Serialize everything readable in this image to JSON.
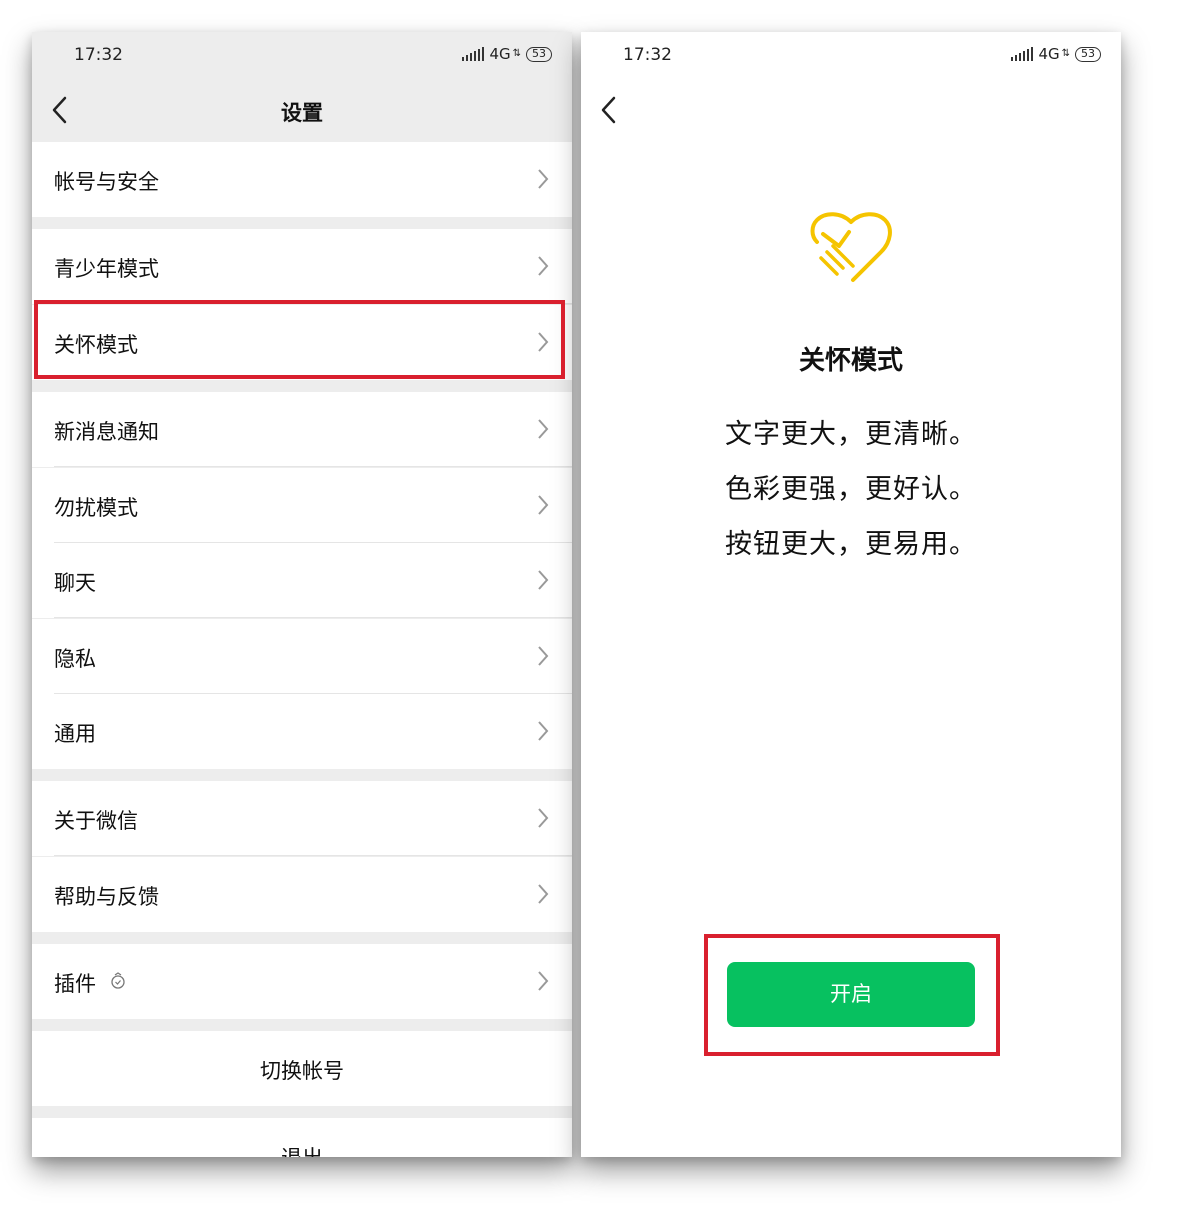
{
  "left_screen": {
    "status": {
      "time": "17:32",
      "network": "4G",
      "battery": "53"
    },
    "nav": {
      "title": "设置"
    },
    "items": [
      {
        "label": "帐号与安全"
      },
      {
        "label": "青少年模式"
      },
      {
        "label": "关怀模式"
      },
      {
        "label": "新消息通知"
      },
      {
        "label": "勿扰模式"
      },
      {
        "label": "聊天"
      },
      {
        "label": "隐私"
      },
      {
        "label": "通用"
      },
      {
        "label": "关于微信"
      },
      {
        "label": "帮助与反馈"
      },
      {
        "label": "插件"
      }
    ],
    "switch_account": "切换帐号",
    "logout": "退出"
  },
  "right_screen": {
    "status": {
      "time": "17:32",
      "network": "4G",
      "battery": "53"
    },
    "title": "关怀模式",
    "lines": [
      "文字更大，更清晰。",
      "色彩更强，更好认。",
      "按钮更大，更易用。"
    ],
    "button_label": "开启"
  },
  "colors": {
    "highlight": "#d9202e",
    "button": "#07c160",
    "logo": "#f5c400"
  }
}
